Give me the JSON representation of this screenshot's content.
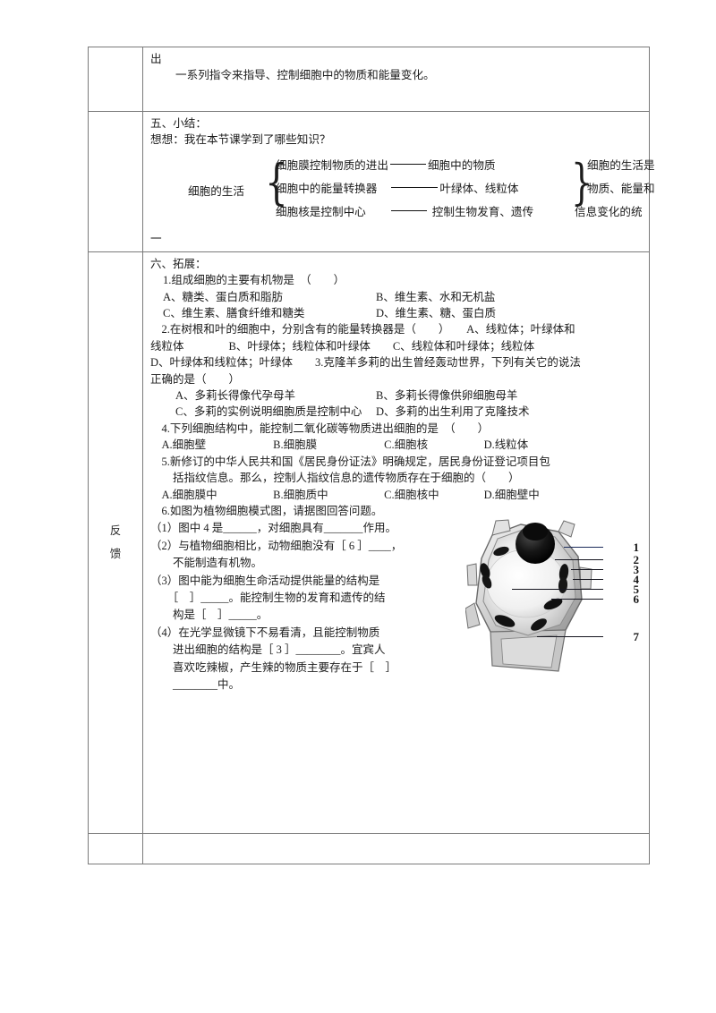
{
  "document": {
    "label_column": {
      "feedback_chars": [
        "反",
        "馈"
      ]
    },
    "row_continuation": {
      "line1": "出",
      "line2": "一系列指令来指导、控制细胞中的物质和能量变化。"
    },
    "row_summary": {
      "heading": "五、小结：",
      "prompt": "想想：我在本节课学到了哪些知识？",
      "diagram": {
        "root": "细胞的生活",
        "rows": [
          {
            "left": "细胞膜控制物质的进出",
            "right": "细胞中的物质",
            "tail": "细胞的生活是"
          },
          {
            "left": "细胞中的能量转换器",
            "right": "叶绿体、线粒体",
            "tail": "物质、能量和"
          },
          {
            "left": "细胞核是控制中心",
            "right": "控制生物发育、遗传",
            "tail": "信息变化的统"
          }
        ],
        "trailing": "一"
      }
    },
    "row_extension": {
      "heading": "六、拓展：",
      "questions": [
        {
          "stem": "1.组成细胞的主要有机物是　（　　）",
          "options": [
            "A、糖类、蛋白质和脂肪",
            "B、维生素、水和无机盐",
            "C、维生素、膳食纤维和糖类",
            "D、维生素、糖、蛋白质"
          ]
        },
        {
          "flow": [
            "　2.在树根和叶的细胞中，分别含有的能量转换器是（　　）　　A、线粒体；叶绿体和",
            "线粒体　　　　B、叶绿体；线粒体和叶绿体　　C、线粒体和叶绿体；线粒体"
          ]
        },
        {
          "flow": [
            "D、叶绿体和线粒体；叶绿体　　3.克隆羊多莉的出生曾经轰动世界，下列有关它的说法",
            "正确的是（　　）"
          ],
          "options": [
            "A、多莉长得像代孕母羊",
            "B、多莉长得像供卵细胞母羊",
            "C、多莉的实例说明细胞质是控制中心",
            "D、多莉的出生利用了克隆技术"
          ]
        },
        {
          "stem": "　4.下列细胞结构中，能控制二氧化碳等物质进出细胞的是　（　　）",
          "options_row": "　A.细胞壁　　　　　　B.细胞膜　　　　　　C.细胞核　　　　　D.线粒体"
        },
        {
          "flow": [
            "　5.新修订的中华人民共和国《居民身份证法》明确规定，居民身份证登记项目包",
            "　　括指纹信息。那么，控制人指纹信息的遗传物质存在于细胞的（　　）"
          ],
          "options_row": "　A.细胞膜中　　　　　B.细胞质中　　　　　C.细胞核中　　　　D.细胞壁中"
        },
        {
          "stem": "　6.如图为植物细胞模式图，请据图回答问题。",
          "sub_items": [
            "（1）图中 4 是______，对细胞具有_______作用。",
            "（2）与植物细胞相比，动物细胞没有［ 6 ］____，",
            "　　不能制造有机物。",
            "（3）图中能为细胞生命活动提供能量的结构是",
            "　　［　］_____。能控制生物的发育和遗传的结",
            "　　构是［　］_____。",
            "（4）在光学显微镜下不易看清，且能控制物质",
            "　　进出细胞的结构是［ 3 ］________。宜宾人",
            "　　喜欢吃辣椒，产生辣的物质主要存在于［　］",
            "　　________中。"
          ]
        }
      ],
      "figure": {
        "name": "plant-cell-diagram",
        "labels": [
          "1",
          "2",
          "3",
          "4",
          "5",
          "6",
          "7"
        ]
      }
    }
  },
  "colors": {
    "border": "#7a7a7a",
    "text": "#1c1c1c",
    "leader": "#15151f"
  }
}
